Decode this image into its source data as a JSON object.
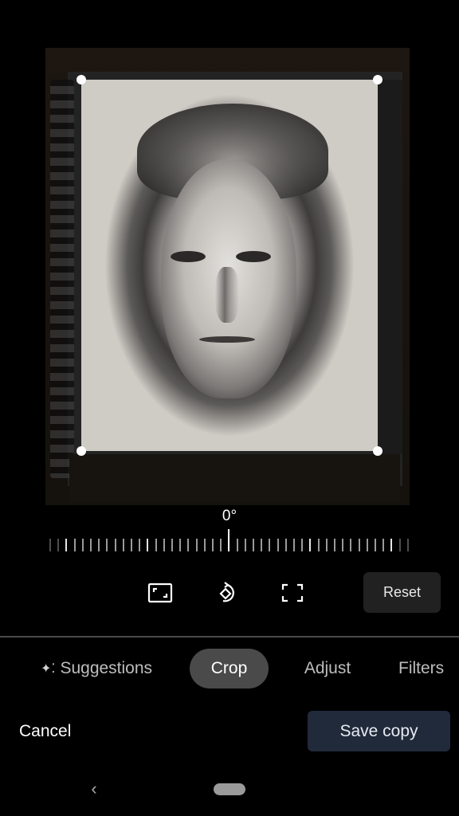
{
  "editor": {
    "rotation_angle": "0°",
    "rotation_value_degrees": 0
  },
  "toolbar": {
    "aspect_ratio_icon": "aspect-ratio-icon",
    "rotate_icon": "rotate-icon",
    "free_crop_icon": "free-crop-icon",
    "reset_label": "Reset"
  },
  "tabs": [
    {
      "label": "Suggestions",
      "icon": "sparkle-icon",
      "active": false
    },
    {
      "label": "Crop",
      "active": true
    },
    {
      "label": "Adjust",
      "active": false
    },
    {
      "label": "Filters",
      "active": false
    }
  ],
  "actions": {
    "cancel_label": "Cancel",
    "save_label": "Save copy"
  },
  "navbar": {
    "back_glyph": "‹"
  },
  "colors": {
    "background": "#000000",
    "active_tab": "#4a4a4a",
    "save_button": "#202a3a",
    "reset_button": "#212121"
  }
}
